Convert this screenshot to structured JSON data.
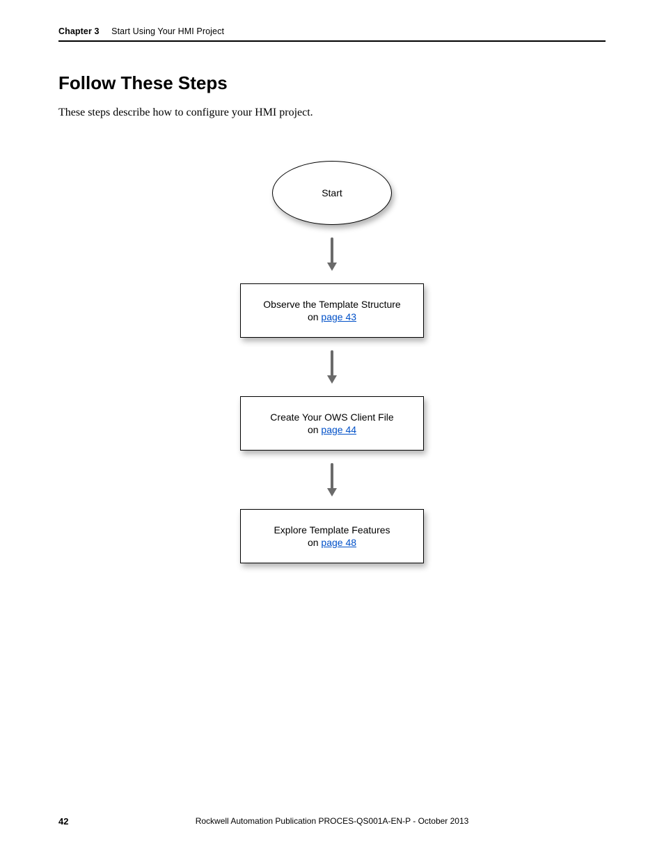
{
  "header": {
    "chapter_label": "Chapter 3",
    "chapter_title": "Start Using Your HMI Project"
  },
  "section": {
    "heading": "Follow These Steps",
    "intro": "These steps describe how to configure your HMI project."
  },
  "flow": {
    "start_label": "Start",
    "steps": [
      {
        "title": "Observe the Template Structure",
        "on_prefix": "on ",
        "link_text": "page 43"
      },
      {
        "title": "Create Your OWS Client File",
        "on_prefix": "on ",
        "link_text": "page 44"
      },
      {
        "title": "Explore Template Features",
        "on_prefix": "on ",
        "link_text": "page 48"
      }
    ]
  },
  "footer": {
    "page_number": "42",
    "publication": "Rockwell Automation Publication PROCES-QS001A-EN-P - October 2013"
  }
}
